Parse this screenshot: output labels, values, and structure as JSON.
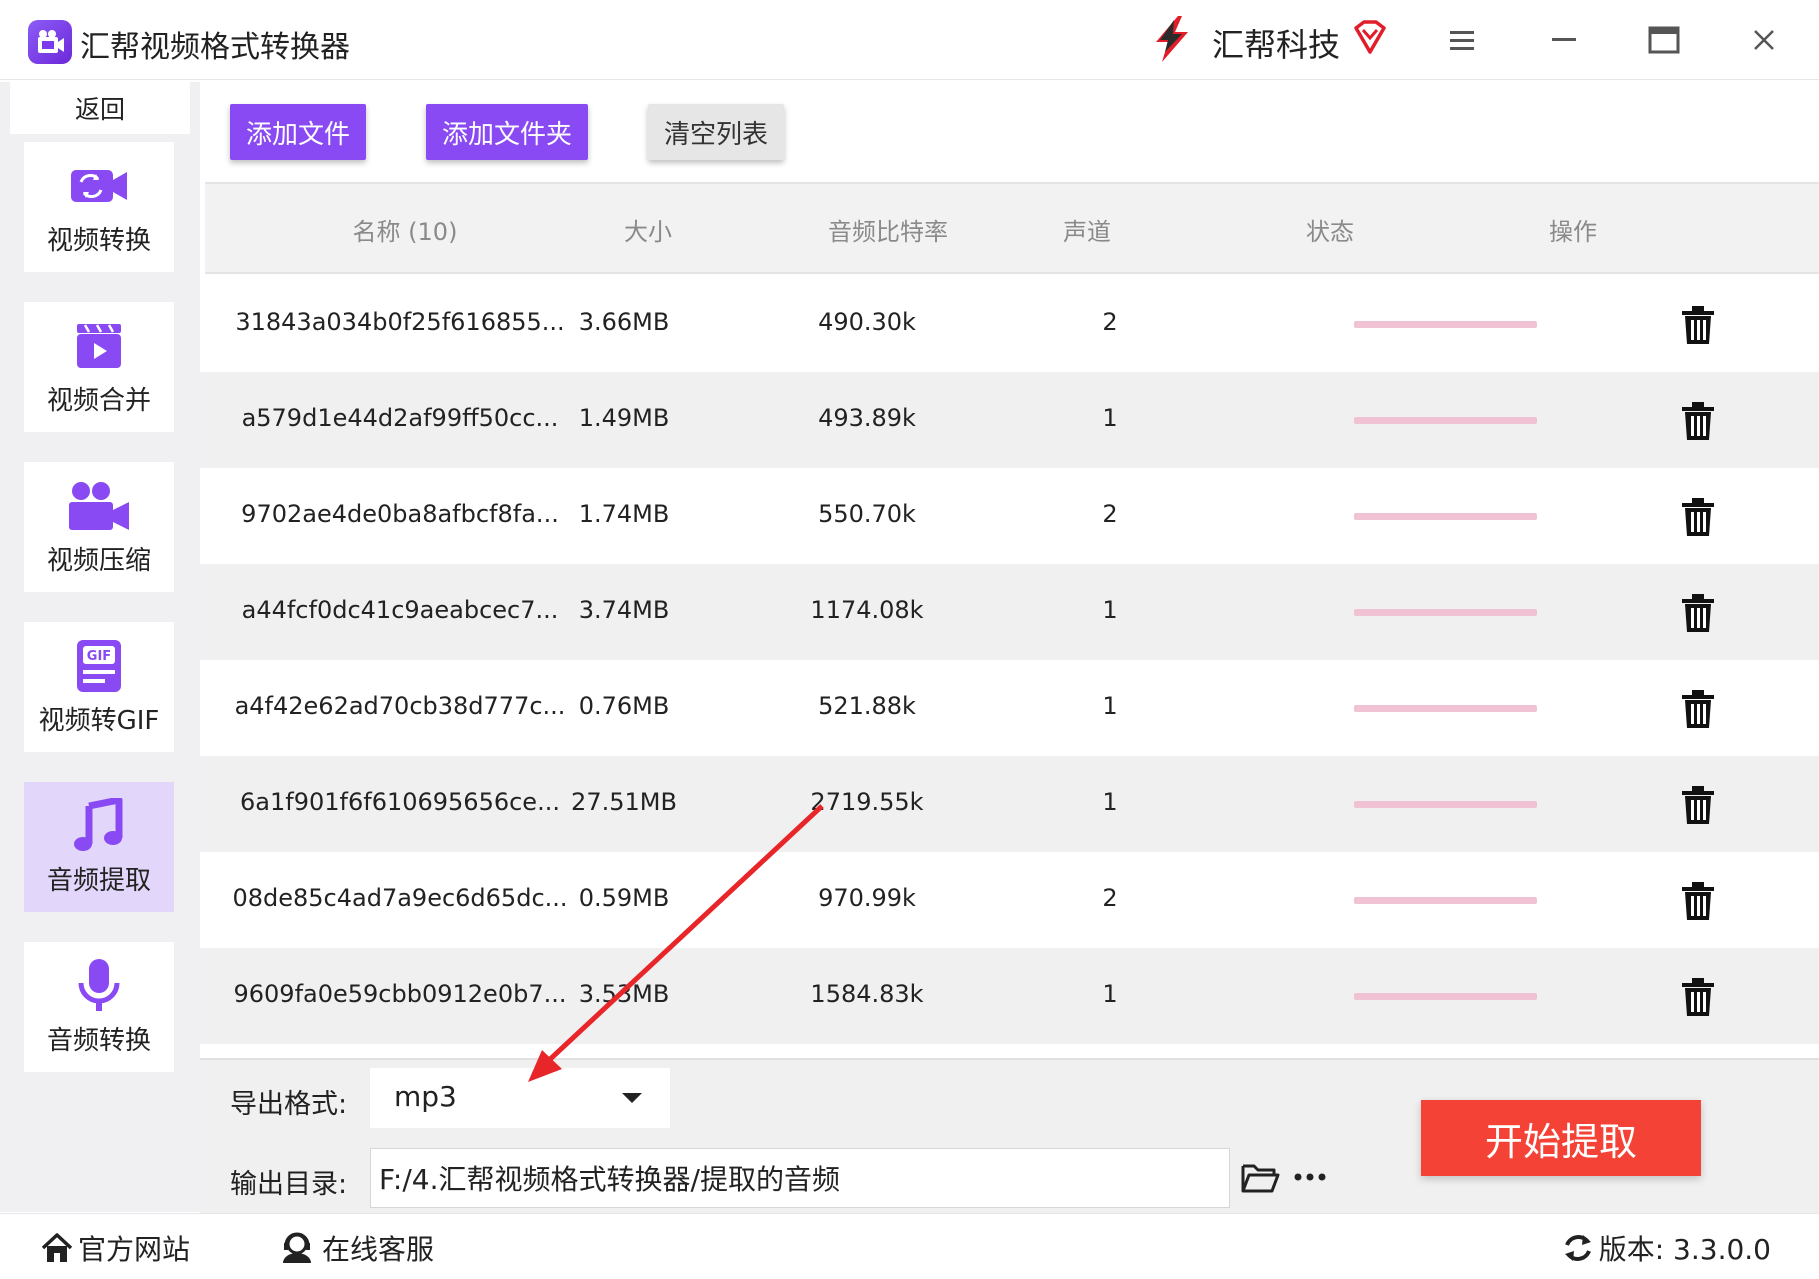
{
  "titlebar": {
    "title": "汇帮视频格式转换器",
    "brand": "汇帮科技"
  },
  "sidebar": {
    "back_label": "返回",
    "items": [
      {
        "label": "视频转换",
        "icon": "video-convert-icon"
      },
      {
        "label": "视频合并",
        "icon": "video-merge-icon"
      },
      {
        "label": "视频压缩",
        "icon": "video-compress-icon"
      },
      {
        "label": "视频转GIF",
        "icon": "gif-icon"
      },
      {
        "label": "音频提取",
        "icon": "music-note-icon",
        "active": true
      },
      {
        "label": "音频转换",
        "icon": "microphone-icon"
      }
    ]
  },
  "toolbar": {
    "add_file": "添加文件",
    "add_folder": "添加文件夹",
    "clear_list": "清空列表"
  },
  "table": {
    "headers": {
      "name": "名称 (10)",
      "size": "大小",
      "bitrate": "音频比特率",
      "channels": "声道",
      "status": "状态",
      "action": "操作"
    },
    "rows": [
      {
        "name": "31843a034b0f25f616855...",
        "size": "3.66MB",
        "bitrate": "490.30k",
        "channels": "2"
      },
      {
        "name": "a579d1e44d2af99ff50cc...",
        "size": "1.49MB",
        "bitrate": "493.89k",
        "channels": "1"
      },
      {
        "name": "9702ae4de0ba8afbcf8fa...",
        "size": "1.74MB",
        "bitrate": "550.70k",
        "channels": "2"
      },
      {
        "name": "a44fcf0dc41c9aeabcec7...",
        "size": "3.74MB",
        "bitrate": "1174.08k",
        "channels": "1"
      },
      {
        "name": "a4f42e62ad70cb38d777c...",
        "size": "0.76MB",
        "bitrate": "521.88k",
        "channels": "1"
      },
      {
        "name": "6a1f901f6f610695656ce...",
        "size": "27.51MB",
        "bitrate": "2719.55k",
        "channels": "1"
      },
      {
        "name": "08de85c4ad7a9ec6d65dc...",
        "size": "0.59MB",
        "bitrate": "970.99k",
        "channels": "2"
      },
      {
        "name": "9609fa0e59cbb0912e0b7...",
        "size": "3.53MB",
        "bitrate": "1584.83k",
        "channels": "1"
      }
    ]
  },
  "export": {
    "format_label": "导出格式:",
    "format_value": "mp3",
    "dir_label": "输出目录:",
    "dir_value": "F:/4.汇帮视频格式转换器/提取的音频",
    "start_label": "开始提取"
  },
  "footer": {
    "website": "官方网站",
    "support": "在线客服",
    "version": "版本:  3.3.0.0"
  },
  "colors": {
    "accent": "#8a4af3",
    "start": "#f44336",
    "status_bar": "#f1c2d3",
    "annotation_arrow": "#e8262a"
  }
}
